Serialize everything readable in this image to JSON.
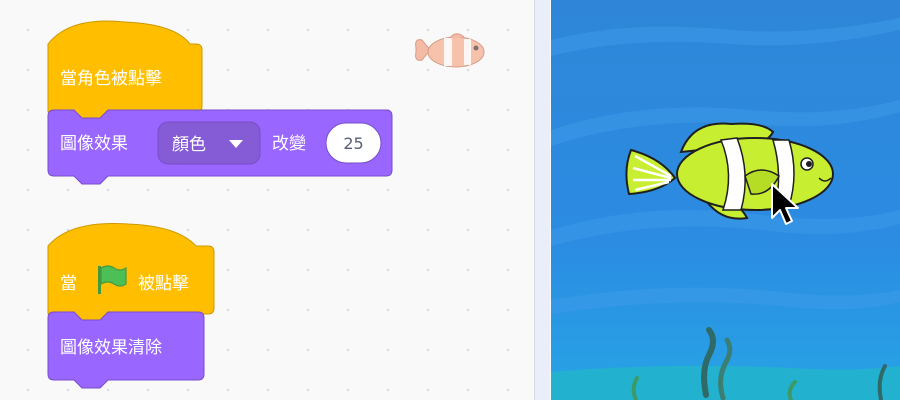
{
  "workspace": {
    "script1": {
      "hat_label": "當角色被點擊",
      "effect_prefix": "圖像效果",
      "effect_dropdown": "顏色",
      "effect_verb": "改變",
      "effect_value": "25"
    },
    "script2": {
      "hat_when": "當",
      "hat_clicked": "被點擊",
      "clear_label": "圖像效果清除"
    },
    "sprite_thumbnail": "clownfish-thumbnail"
  },
  "stage": {
    "sprite": "clownfish",
    "cursor": "mouse-pointer"
  },
  "colors": {
    "events": "#ffbf00",
    "events_border": "#cc9900",
    "looks": "#9966ff",
    "looks_border": "#774dcb",
    "stage_water": "#2f8de0"
  }
}
